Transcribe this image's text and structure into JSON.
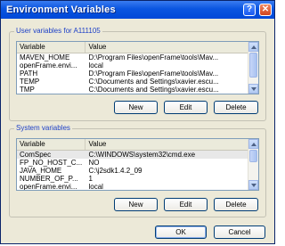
{
  "window": {
    "title": "Environment Variables"
  },
  "titlebar_buttons": {
    "help": "?",
    "close": "✕"
  },
  "user_group": {
    "title": "User variables for A111105",
    "title_mnemonic_index": 0,
    "columns": [
      "Variable",
      "Value"
    ],
    "rows": [
      {
        "variable": "MAVEN_HOME",
        "value": "D:\\Program Files\\openFrame\\tools\\Mav..."
      },
      {
        "variable": "openFrame.envi...",
        "value": "local"
      },
      {
        "variable": "PATH",
        "value": "D:\\Program Files\\openFrame\\tools\\Mav..."
      },
      {
        "variable": "TEMP",
        "value": "C:\\Documents and Settings\\xavier.escu..."
      },
      {
        "variable": "TMP",
        "value": "C:\\Documents and Settings\\xavier.escu..."
      }
    ],
    "buttons": {
      "new": "New",
      "edit": "Edit",
      "delete": "Delete"
    }
  },
  "system_group": {
    "title": "System variables",
    "columns": [
      "Variable",
      "Value"
    ],
    "rows": [
      {
        "variable": "ComSpec",
        "value": "C:\\WINDOWS\\system32\\cmd.exe"
      },
      {
        "variable": "FP_NO_HOST_C...",
        "value": "NO"
      },
      {
        "variable": "JAVA_HOME",
        "value": "C:\\j2sdk1.4.2_09"
      },
      {
        "variable": "NUMBER_OF_P...",
        "value": "1"
      },
      {
        "variable": "openFrame.envi...",
        "value": "local"
      }
    ],
    "buttons": {
      "new": "New",
      "edit": "Edit",
      "delete": "Delete"
    }
  },
  "dialog_buttons": {
    "ok": "OK",
    "cancel": "Cancel"
  }
}
